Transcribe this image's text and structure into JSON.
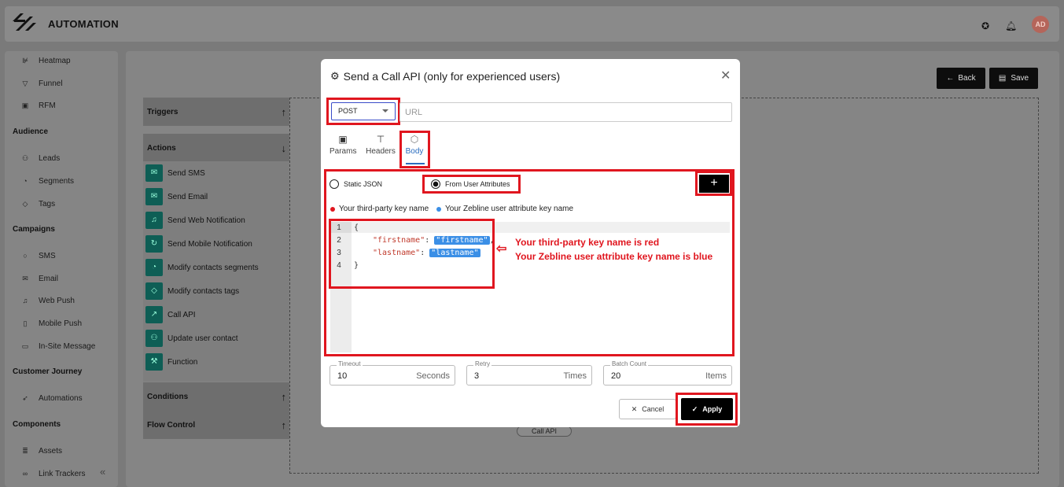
{
  "app": {
    "title": "AUTOMATION",
    "avatar": "AD"
  },
  "sidebar": {
    "items": [
      {
        "label": "Heatmap",
        "icon": "heatmap-icon",
        "glyph": "⊯"
      },
      {
        "label": "Funnel",
        "icon": "funnel-icon",
        "glyph": "▽"
      },
      {
        "label": "RFM",
        "icon": "rfm-icon",
        "glyph": "▣"
      }
    ],
    "audience": {
      "heading": "Audience",
      "items": [
        {
          "label": "Leads",
          "icon": "users-icon",
          "glyph": "⚇"
        },
        {
          "label": "Segments",
          "icon": "pie-icon",
          "glyph": "◔"
        },
        {
          "label": "Tags",
          "icon": "tag-icon",
          "glyph": "◇"
        }
      ]
    },
    "campaigns": {
      "heading": "Campaigns",
      "items": [
        {
          "label": "SMS",
          "icon": "sms-icon",
          "glyph": "○"
        },
        {
          "label": "Email",
          "icon": "email-icon",
          "glyph": "✉"
        },
        {
          "label": "Web Push",
          "icon": "bell-icon",
          "glyph": "♫"
        },
        {
          "label": "Mobile Push",
          "icon": "mobile-icon",
          "glyph": "▯"
        },
        {
          "label": "In-Site Message",
          "icon": "message-icon",
          "glyph": "▭"
        }
      ]
    },
    "journey": {
      "heading": "Customer Journey",
      "items": [
        {
          "label": "Automations",
          "icon": "rocket-icon",
          "glyph": "➶"
        }
      ]
    },
    "components": {
      "heading": "Components",
      "items": [
        {
          "label": "Assets",
          "icon": "assets-icon",
          "glyph": "≣"
        },
        {
          "label": "Link Trackers",
          "icon": "link-icon",
          "glyph": "∞"
        }
      ]
    }
  },
  "toolbar": {
    "back": "Back",
    "save": "Save"
  },
  "panel": {
    "triggers": "Triggers",
    "actions": "Actions",
    "conditions": "Conditions",
    "flow_control": "Flow Control",
    "action_items": [
      "Send SMS",
      "Send Email",
      "Send Web Notification",
      "Send Mobile Notification",
      "Modify contacts segments",
      "Modify contacts tags",
      "Call API",
      "Update user contact",
      "Function"
    ]
  },
  "canvas": {
    "node_label": "Call API"
  },
  "modal": {
    "title": "Send a Call API (only for experienced users)",
    "method": "POST",
    "url_placeholder": "URL",
    "tabs": [
      "Params",
      "Headers",
      "Body"
    ],
    "active_tab": "Body",
    "radio_static": "Static JSON",
    "radio_user": "From User Attributes",
    "legend_red": "Your third-party key name",
    "legend_blue": "Your Zebline user attribute key name",
    "code": {
      "open": "{",
      "line2_key": "\"firstname\"",
      "line2_val": "\"firstname\"",
      "line3_key": "\"lastname\"",
      "line3_val": "\"lastname\"",
      "close": "}",
      "colon": ":",
      "comma": ","
    },
    "line_numbers": [
      "1",
      "2",
      "3",
      "4"
    ],
    "annotation_1": "Your third-party key name is red",
    "annotation_2": "Your Zebline user attribute key name is blue",
    "timeout": {
      "label": "Timeout",
      "value": "10",
      "unit": "Seconds"
    },
    "retry": {
      "label": "Retry",
      "value": "3",
      "unit": "Times"
    },
    "batch": {
      "label": "Batch Count",
      "value": "20",
      "unit": "Items"
    },
    "cancel": "Cancel",
    "apply": "Apply"
  },
  "colors": {
    "accent_red": "#e0161f",
    "key_red": "#c0392b",
    "attr_blue": "#3b8fe6",
    "tab_blue": "#2a6dbf"
  }
}
